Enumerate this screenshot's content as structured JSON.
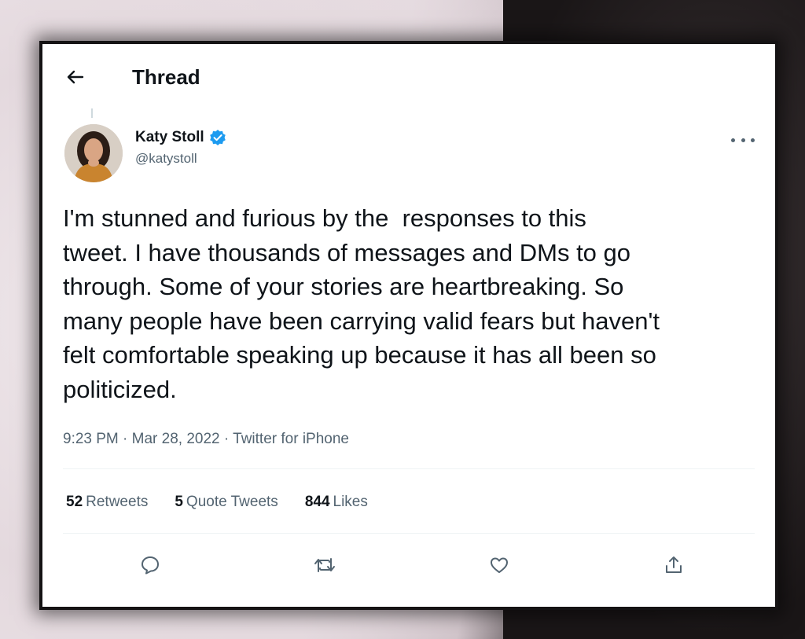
{
  "header": {
    "title": "Thread"
  },
  "tweet": {
    "author_name": "Katy Stoll",
    "author_handle": "@katystoll",
    "text": "I'm stunned and furious by the  responses to this\ntweet. I have thousands of messages and DMs to go\nthrough. Some of your stories are heartbreaking. So\nmany people have been carrying valid fears but haven't\nfelt comfortable speaking up because it has all been so\npoliticized.",
    "meta": "9:23 PM · Mar 28, 2022 · Twitter for iPhone"
  },
  "stats": {
    "retweets_count": "52",
    "retweets_label": "Retweets",
    "quotes_count": "5",
    "quotes_label": "Quote Tweets",
    "likes_count": "844",
    "likes_label": "Likes"
  },
  "icons": {
    "back": "arrow-left-icon",
    "verified": "verified-badge-icon",
    "more": "more-dots-icon",
    "reply": "reply-bubble-icon",
    "retweet": "retweet-icon",
    "like": "heart-icon",
    "share": "share-icon"
  },
  "colors": {
    "verified_blue": "#1d9bf0",
    "text_primary": "#0f1419",
    "text_secondary": "#536471"
  }
}
